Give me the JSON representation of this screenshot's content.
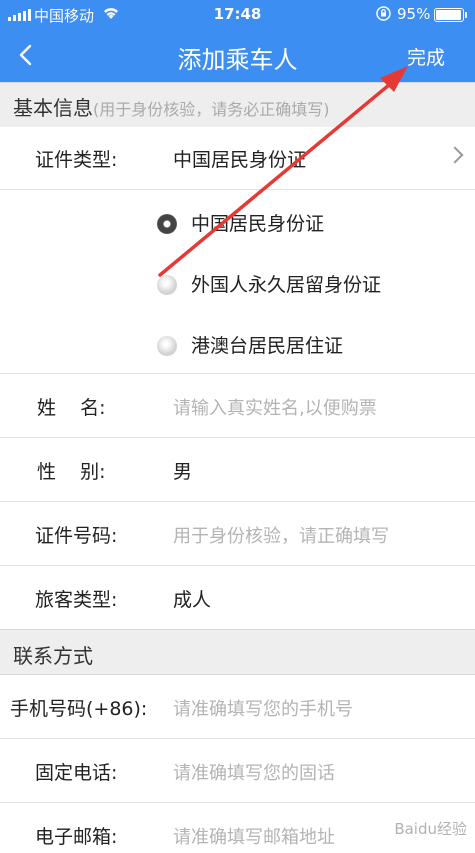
{
  "status": {
    "carrier": "中国移动",
    "time": "17:48",
    "battery": "95%",
    "battery_level": 0.95,
    "icons": [
      "signal-icon",
      "wifi-icon",
      "rotation-lock-icon",
      "battery-icon"
    ]
  },
  "nav": {
    "title": "添加乘车人",
    "done": "完成",
    "back_icon": "chevron-left-icon"
  },
  "basic": {
    "header": "基本信息",
    "header_sub": "(用于身份核验，请务必正确填写)",
    "id_type_label": "证件类型:",
    "id_type_value": "中国居民身份证",
    "options": [
      {
        "label": "中国居民身份证",
        "selected": true
      },
      {
        "label": "外国人永久居留身份证",
        "selected": false
      },
      {
        "label": "港澳台居民居住证",
        "selected": false
      }
    ],
    "name_label": "姓    名:",
    "name_placeholder": "请输入真实姓名,以便购票",
    "gender_label": "性    别:",
    "gender_value": "男",
    "id_no_label": "证件号码:",
    "id_no_placeholder": "用于身份核验，请正确填写",
    "passenger_type_label": "旅客类型:",
    "passenger_type_value": "成人"
  },
  "contact": {
    "header": "联系方式",
    "mobile_label": "手机号码(+86):",
    "mobile_placeholder": "请准确填写您的手机号",
    "phone_label": "固定电话:",
    "phone_placeholder": "请准确填写您的固话",
    "email_label": "电子邮箱:",
    "email_placeholder": "请准确填写邮箱地址"
  },
  "annotation": {
    "color": "#e53935"
  },
  "watermark": "Baidu经验"
}
